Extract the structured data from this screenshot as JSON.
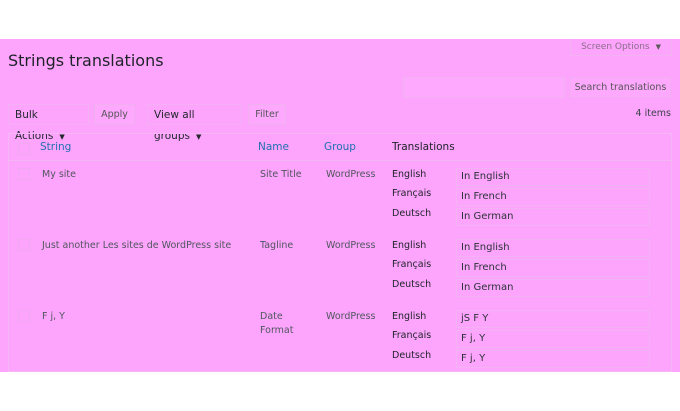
{
  "header": {
    "screen_options_label": "Screen Options",
    "page_title": "Strings translations"
  },
  "toolbar": {
    "search_placeholder": "",
    "search_button_label": "Search translations",
    "bulk_actions_label": "Bulk Actions",
    "apply_label": "Apply",
    "group_filter_label": "View all groups",
    "filter_label": "Filter",
    "items_count": "4 items"
  },
  "table": {
    "columns": [
      "String",
      "Name",
      "Group",
      "Translations"
    ],
    "rows": [
      {
        "string": "My site",
        "name": "Site Title",
        "group": "WordPress",
        "translations": [
          {
            "language": "English",
            "value": "In English"
          },
          {
            "language": "Français",
            "value": "In French"
          },
          {
            "language": "Deutsch",
            "value": "In German"
          }
        ]
      },
      {
        "string": "Just another Les sites de WordPress site",
        "name": "Tagline",
        "group": "WordPress",
        "translations": [
          {
            "language": "English",
            "value": "In English"
          },
          {
            "language": "Français",
            "value": "In French"
          },
          {
            "language": "Deutsch",
            "value": "In German"
          }
        ]
      },
      {
        "string": "F j, Y",
        "name": "Date Format",
        "group": "WordPress",
        "translations": [
          {
            "language": "English",
            "value": "jS F Y"
          },
          {
            "language": "Français",
            "value": "F j, Y"
          },
          {
            "language": "Deutsch",
            "value": "F j, Y"
          }
        ]
      }
    ]
  },
  "colors": {
    "background": "#fda4fd",
    "link": "#2271b1"
  }
}
